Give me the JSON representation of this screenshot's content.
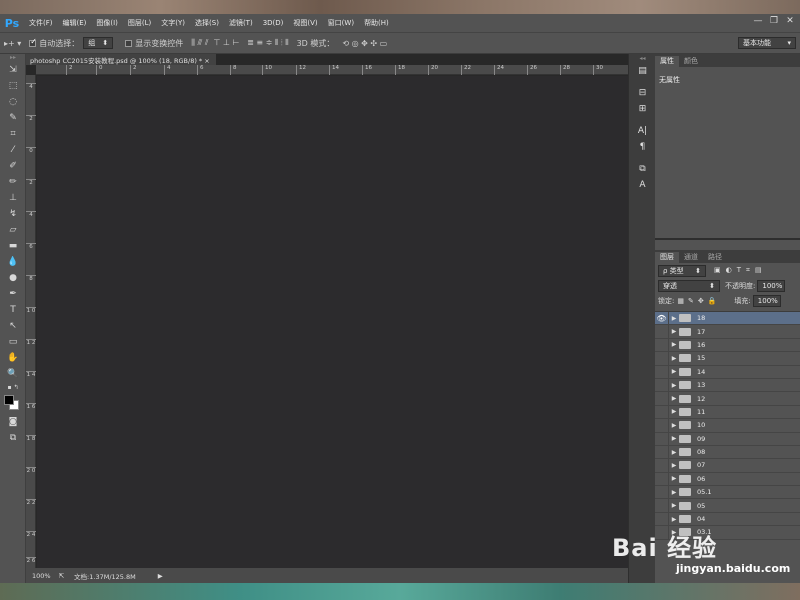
{
  "app": {
    "logo": "Ps"
  },
  "menubar": {
    "items": [
      "文件(F)",
      "编辑(E)",
      "图像(I)",
      "图层(L)",
      "文字(Y)",
      "选择(S)",
      "滤镜(T)",
      "3D(D)",
      "视图(V)",
      "窗口(W)",
      "帮助(H)"
    ]
  },
  "window_controls": {
    "minimize": "—",
    "restore": "❐",
    "close": "✕"
  },
  "options_bar": {
    "auto_select_label": "自动选择：",
    "auto_select_value": "组",
    "show_transform_label": "显示变换控件",
    "mode_3d_label": "3D 模式：",
    "workspace": "基本功能"
  },
  "document": {
    "tab_title": "photoshp CC2015安装教程.psd @ 100% (18, RGB/8) *",
    "tab_close": "×"
  },
  "ruler": {
    "h_ticks": [
      "2",
      "0",
      "2",
      "4",
      "6",
      "8",
      "10",
      "12",
      "14",
      "16",
      "18",
      "20",
      "22",
      "24",
      "26",
      "28",
      "30"
    ],
    "v_ticks": [
      "4",
      "2",
      "0",
      "2",
      "4",
      "6",
      "8",
      "1 0",
      "1 2",
      "1 4",
      "1 6",
      "1 8",
      "2 0",
      "2 2",
      "2 4",
      "2 6"
    ]
  },
  "status": {
    "zoom": "100%",
    "doc_info": "文档:1.37M/125.8M"
  },
  "properties_panel": {
    "tabs": [
      "属性",
      "颜色"
    ],
    "body": "无属性"
  },
  "layers_panel": {
    "tabs": [
      "图层",
      "通道",
      "路径"
    ],
    "filter_label": "ρ 类型",
    "blend_mode": "穿透",
    "opacity_label": "不透明度:",
    "opacity_value": "100%",
    "lock_label": "锁定:",
    "fill_label": "填充:",
    "fill_value": "100%",
    "layers": [
      "18",
      "17",
      "16",
      "15",
      "14",
      "13",
      "12",
      "11",
      "10",
      "09",
      "08",
      "07",
      "06",
      "05.1",
      "05",
      "04",
      "03.1"
    ]
  },
  "watermark": {
    "brand": "Bai 经验",
    "url": "jingyan.baidu.com"
  },
  "colors": {
    "accent": "#31a8ff",
    "selection": "#5c6f8a",
    "canvas": "#2c2b2d"
  }
}
